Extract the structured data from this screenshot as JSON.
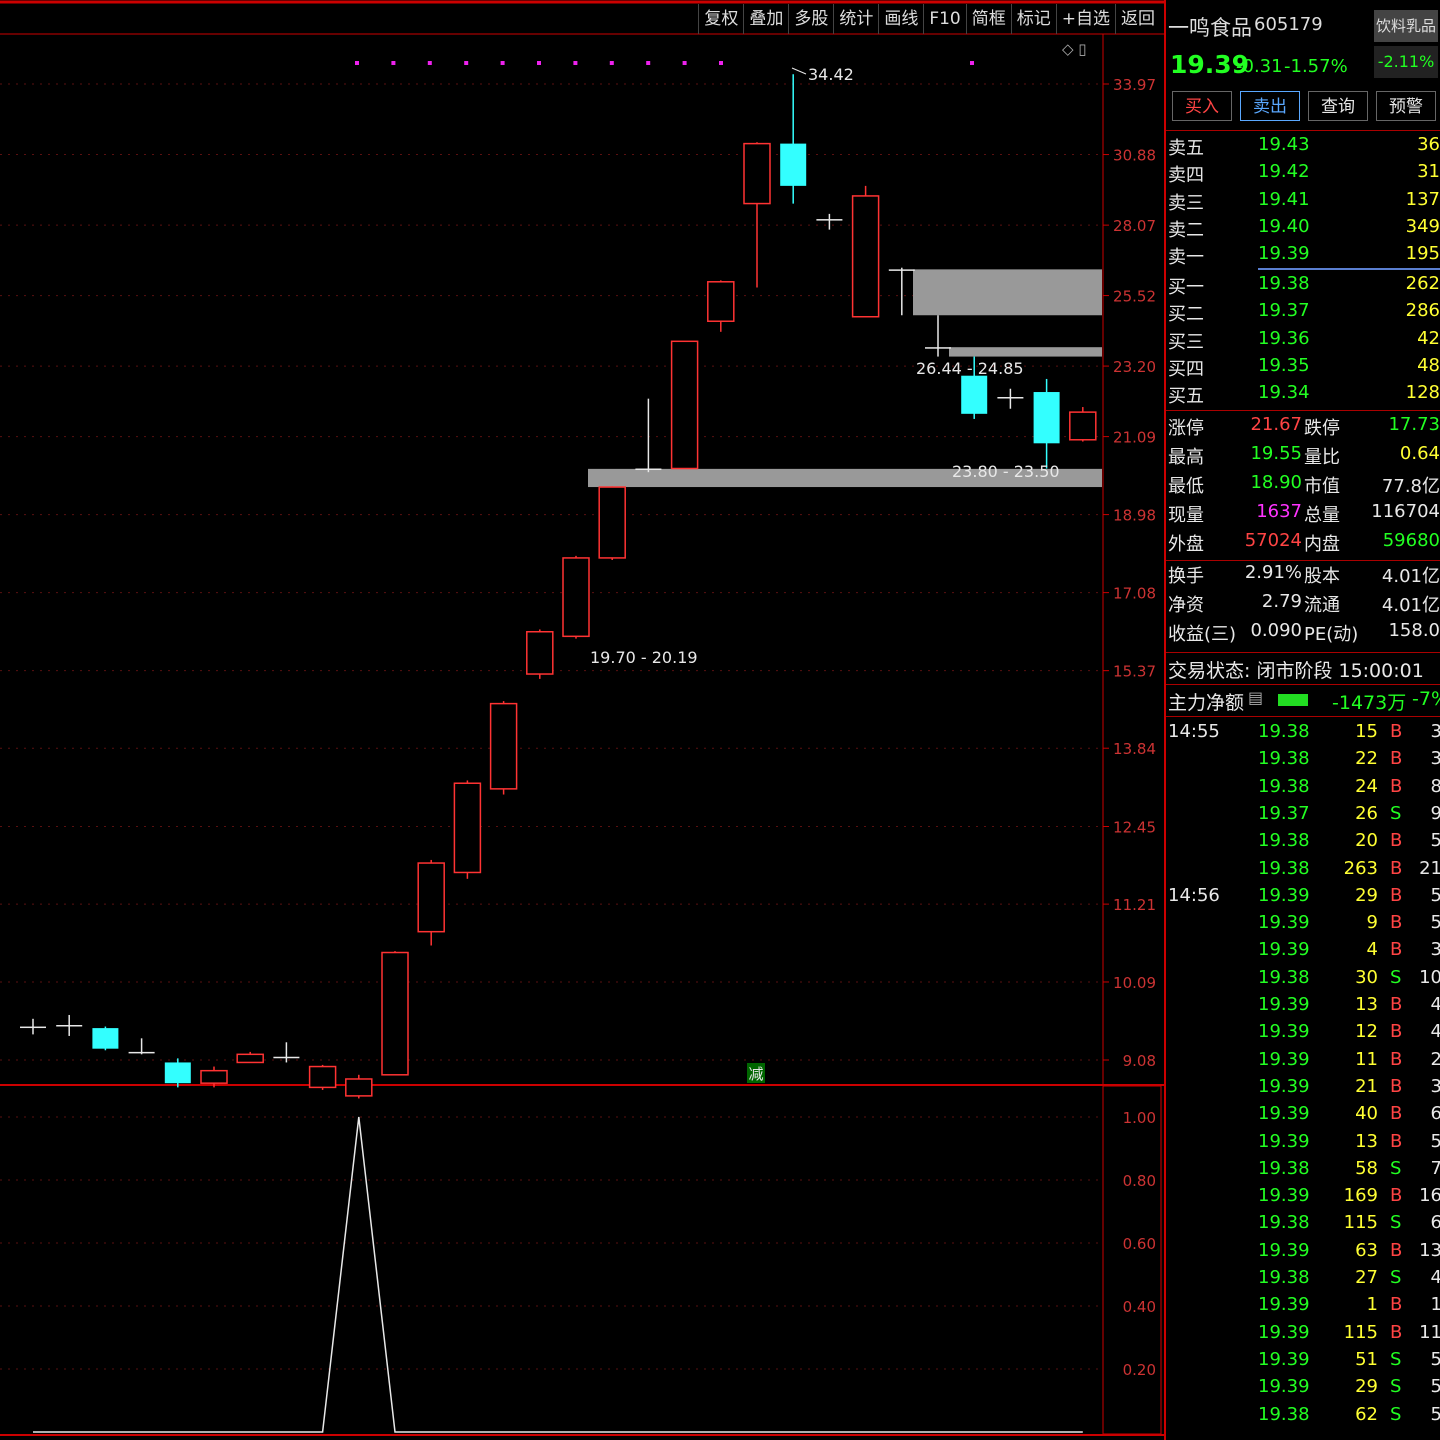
{
  "toolbar": [
    "复权",
    "叠加",
    "多股",
    "统计",
    "画线",
    "F10",
    "简框",
    "标记",
    "+自选",
    "返回"
  ],
  "chart_data": {
    "type": "candlestick",
    "price_axis": [
      "33.97",
      "30.88",
      "28.07",
      "25.52",
      "23.20",
      "21.09",
      "18.98",
      "17.08",
      "15.37",
      "13.84",
      "12.45",
      "11.21",
      "10.09",
      "9.08"
    ],
    "indicator_axis": [
      "1.00",
      "0.80",
      "0.60",
      "0.40",
      "0.20"
    ],
    "candles": [
      {
        "o": 9.5,
        "c": 9.5,
        "h": 9.6,
        "l": 9.4
      },
      {
        "o": 9.52,
        "c": 9.52,
        "h": 9.65,
        "l": 9.38
      },
      {
        "o": 9.48,
        "c": 9.22,
        "h": 9.5,
        "l": 9.2
      },
      {
        "o": 9.18,
        "c": 9.18,
        "h": 9.35,
        "l": 9.15
      },
      {
        "o": 9.05,
        "c": 8.8,
        "h": 9.1,
        "l": 8.75
      },
      {
        "o": 8.8,
        "c": 8.95,
        "h": 9.0,
        "l": 8.75
      },
      {
        "o": 9.05,
        "c": 9.15,
        "h": 9.18,
        "l": 9.05
      },
      {
        "o": 9.12,
        "c": 9.12,
        "h": 9.3,
        "l": 9.05
      },
      {
        "o": 8.75,
        "c": 9.0,
        "h": 9.02,
        "l": 8.72
      },
      {
        "o": 8.65,
        "c": 8.85,
        "h": 8.9,
        "l": 8.62
      },
      {
        "o": 8.9,
        "c": 10.5,
        "h": 10.52,
        "l": 8.9
      },
      {
        "o": 10.8,
        "c": 11.85,
        "h": 11.9,
        "l": 10.6
      },
      {
        "o": 11.7,
        "c": 13.2,
        "h": 13.25,
        "l": 11.6
      },
      {
        "o": 13.1,
        "c": 14.7,
        "h": 14.75,
        "l": 13.0
      },
      {
        "o": 15.3,
        "c": 16.2,
        "h": 16.25,
        "l": 15.2
      },
      {
        "o": 16.1,
        "c": 17.9,
        "h": 17.95,
        "l": 16.05
      },
      {
        "o": 17.9,
        "c": 19.7,
        "h": 19.72,
        "l": 17.85
      },
      {
        "o": 20.2,
        "c": 20.2,
        "h": 22.2,
        "l": 20.1
      },
      {
        "o": 20.2,
        "c": 23.99,
        "h": 24.0,
        "l": 20.2
      },
      {
        "o": 24.65,
        "c": 26.0,
        "h": 26.05,
        "l": 24.3
      },
      {
        "o": 28.9,
        "c": 31.34,
        "h": 31.4,
        "l": 25.8
      },
      {
        "o": 31.34,
        "c": 29.6,
        "h": 34.42,
        "l": 28.9
      },
      {
        "o": 28.3,
        "c": 28.3,
        "h": 28.5,
        "l": 27.9
      },
      {
        "o": 24.8,
        "c": 29.2,
        "h": 29.6,
        "l": 24.8
      },
      {
        "o": 26.44,
        "c": 26.44,
        "h": 26.5,
        "l": 24.85
      },
      {
        "o": 23.8,
        "c": 23.8,
        "h": 24.85,
        "l": 23.5
      },
      {
        "o": 22.9,
        "c": 21.75,
        "h": 23.5,
        "l": 21.6
      },
      {
        "o": 22.25,
        "c": 22.25,
        "h": 22.5,
        "l": 21.9
      },
      {
        "o": 22.4,
        "c": 20.9,
        "h": 22.8,
        "l": 20.2
      },
      {
        "o": 21.0,
        "c": 21.8,
        "h": 21.95,
        "l": 20.95
      }
    ],
    "annotations": [
      "34.42",
      "26.44 - 24.85",
      "23.80 - 23.50",
      "19.70 - 20.19"
    ],
    "signal_label": "减",
    "indicator_line": [
      0,
      0,
      0,
      0,
      0,
      0,
      0,
      0,
      0,
      1,
      0,
      0,
      0,
      0,
      0,
      0,
      0,
      0,
      0,
      0,
      0,
      0,
      0,
      0,
      0,
      0,
      0,
      0,
      0,
      0
    ]
  },
  "panel": {
    "name": "一鸣食品",
    "code": "605179",
    "sector": "饮料乳品",
    "price": "19.39",
    "change": "-0.31",
    "change_pct": "-1.57%",
    "sector_pct": "-2.11%",
    "buttons": [
      "买入",
      "卖出",
      "查询",
      "预警"
    ],
    "asks": [
      {
        "label": "卖五",
        "price": "19.43",
        "vol": "36"
      },
      {
        "label": "卖四",
        "price": "19.42",
        "vol": "31"
      },
      {
        "label": "卖三",
        "price": "19.41",
        "vol": "137"
      },
      {
        "label": "卖二",
        "price": "19.40",
        "vol": "349"
      },
      {
        "label": "卖一",
        "price": "19.39",
        "vol": "195"
      }
    ],
    "bids": [
      {
        "label": "买一",
        "price": "19.38",
        "vol": "262"
      },
      {
        "label": "买二",
        "price": "19.37",
        "vol": "286"
      },
      {
        "label": "买三",
        "price": "19.36",
        "vol": "42"
      },
      {
        "label": "买四",
        "price": "19.35",
        "vol": "48"
      },
      {
        "label": "买五",
        "price": "19.34",
        "vol": "128"
      }
    ],
    "stats": [
      {
        "l1": "涨停",
        "v1": "21.67",
        "l2": "跌停",
        "v2": "17.73"
      },
      {
        "l1": "最高",
        "v1": "19.55",
        "l2": "量比",
        "v2": "0.64"
      },
      {
        "l1": "最低",
        "v1": "18.90",
        "l2": "市值",
        "v2": "77.8亿"
      },
      {
        "l1": "现量",
        "v1": "1637",
        "l2": "总量",
        "v2": "116704"
      },
      {
        "l1": "外盘",
        "v1": "57024",
        "l2": "内盘",
        "v2": "59680"
      }
    ],
    "stats2": [
      {
        "l1": "换手",
        "v1": "2.91%",
        "l2": "股本",
        "v2": "4.01亿"
      },
      {
        "l1": "净资",
        "v1": "2.79",
        "l2": "流通",
        "v2": "4.01亿"
      },
      {
        "l1": "收益(三)",
        "v1": "0.090",
        "l2": "PE(动)",
        "v2": "158.0"
      }
    ],
    "status": "交易状态: 闭市阶段 15:00:01",
    "main_flow_label": "主力净额",
    "main_flow_value": "-1473万",
    "main_flow_pct": "-7%",
    "ticks": [
      {
        "t": "14:55",
        "p": "19.38",
        "v": "15",
        "s": "B",
        "n": "3"
      },
      {
        "t": "",
        "p": "19.38",
        "v": "22",
        "s": "B",
        "n": "3"
      },
      {
        "t": "",
        "p": "19.38",
        "v": "24",
        "s": "B",
        "n": "8"
      },
      {
        "t": "",
        "p": "19.37",
        "v": "26",
        "s": "S",
        "n": "9"
      },
      {
        "t": "",
        "p": "19.38",
        "v": "20",
        "s": "B",
        "n": "5"
      },
      {
        "t": "",
        "p": "19.38",
        "v": "263",
        "s": "B",
        "n": "21"
      },
      {
        "t": "14:56",
        "p": "19.39",
        "v": "29",
        "s": "B",
        "n": "5"
      },
      {
        "t": "",
        "p": "19.39",
        "v": "9",
        "s": "B",
        "n": "5"
      },
      {
        "t": "",
        "p": "19.39",
        "v": "4",
        "s": "B",
        "n": "3"
      },
      {
        "t": "",
        "p": "19.38",
        "v": "30",
        "s": "S",
        "n": "10"
      },
      {
        "t": "",
        "p": "19.39",
        "v": "13",
        "s": "B",
        "n": "4"
      },
      {
        "t": "",
        "p": "19.39",
        "v": "12",
        "s": "B",
        "n": "4"
      },
      {
        "t": "",
        "p": "19.39",
        "v": "11",
        "s": "B",
        "n": "2"
      },
      {
        "t": "",
        "p": "19.39",
        "v": "21",
        "s": "B",
        "n": "3"
      },
      {
        "t": "",
        "p": "19.39",
        "v": "40",
        "s": "B",
        "n": "6"
      },
      {
        "t": "",
        "p": "19.39",
        "v": "13",
        "s": "B",
        "n": "5"
      },
      {
        "t": "",
        "p": "19.38",
        "v": "58",
        "s": "S",
        "n": "7"
      },
      {
        "t": "",
        "p": "19.39",
        "v": "169",
        "s": "B",
        "n": "16"
      },
      {
        "t": "",
        "p": "19.38",
        "v": "115",
        "s": "S",
        "n": "6"
      },
      {
        "t": "",
        "p": "19.39",
        "v": "63",
        "s": "B",
        "n": "13"
      },
      {
        "t": "",
        "p": "19.38",
        "v": "27",
        "s": "S",
        "n": "4"
      },
      {
        "t": "",
        "p": "19.39",
        "v": "1",
        "s": "B",
        "n": "1"
      },
      {
        "t": "",
        "p": "19.39",
        "v": "115",
        "s": "B",
        "n": "11"
      },
      {
        "t": "",
        "p": "19.39",
        "v": "51",
        "s": "S",
        "n": "5"
      },
      {
        "t": "",
        "p": "19.39",
        "v": "29",
        "s": "S",
        "n": "5"
      },
      {
        "t": "",
        "p": "19.38",
        "v": "62",
        "s": "S",
        "n": "5"
      }
    ]
  }
}
